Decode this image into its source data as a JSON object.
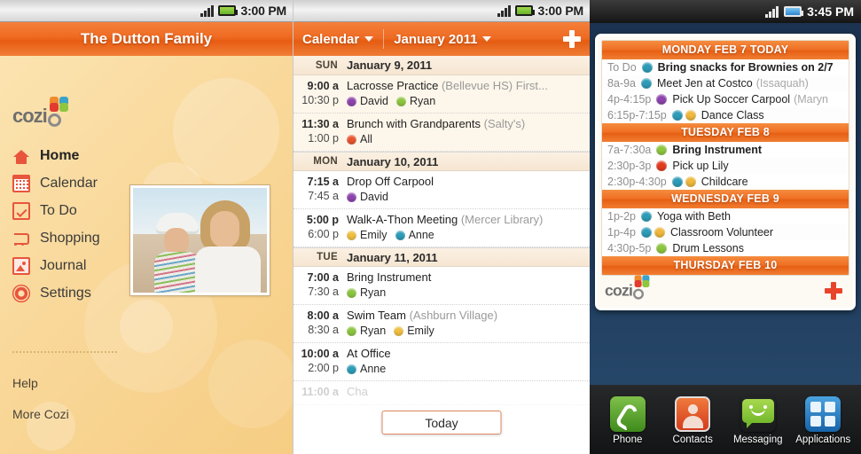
{
  "panel1": {
    "statusbar": {
      "time": "3:00 PM",
      "signal_icon": "signal-bars-icon",
      "battery_icon": "battery-icon"
    },
    "header_title": "The Dutton Family",
    "logo_text": "cozi",
    "nav": [
      {
        "label": "Home",
        "icon": "home-icon",
        "active": true
      },
      {
        "label": "Calendar",
        "icon": "calendar-icon",
        "active": false
      },
      {
        "label": "To Do",
        "icon": "checkbox-icon",
        "active": false
      },
      {
        "label": "Shopping",
        "icon": "cart-icon",
        "active": false
      },
      {
        "label": "Journal",
        "icon": "photo-icon",
        "active": false
      },
      {
        "label": "Settings",
        "icon": "gear-icon",
        "active": false
      }
    ],
    "links": [
      {
        "label": "Help"
      },
      {
        "label": "More Cozi"
      }
    ],
    "photo_alt": "family-photo"
  },
  "panel2": {
    "statusbar": {
      "time": "3:00 PM"
    },
    "header": {
      "menu_label": "Calendar",
      "month_label": "January 2011",
      "add_icon": "plus-icon"
    },
    "days": [
      {
        "dow": "SUN",
        "date": "January 9, 2011",
        "highlight": true,
        "events": [
          {
            "start": "9:00 a",
            "end": "10:30 p",
            "title": "Lacrosse Practice",
            "location": "(Bellevue HS) First...",
            "people": [
              {
                "name": "David",
                "color": "#8E44AD"
              },
              {
                "name": "Ryan",
                "color": "#8DC63F"
              }
            ]
          },
          {
            "start": "11:30 a",
            "end": "1:00 p",
            "title": "Brunch with Grandparents",
            "location": "(Salty's)",
            "people": [
              {
                "name": "All",
                "color": "#E8552E"
              }
            ]
          }
        ]
      },
      {
        "dow": "MON",
        "date": "January 10, 2011",
        "highlight": false,
        "events": [
          {
            "start": "7:15 a",
            "end": "7:45 a",
            "title": "Drop Off Carpool",
            "location": "",
            "people": [
              {
                "name": "David",
                "color": "#8E44AD"
              }
            ]
          },
          {
            "start": "5:00 p",
            "end": "6:00 p",
            "title": "Walk-A-Thon Meeting",
            "location": "(Mercer Library)",
            "people": [
              {
                "name": "Emily",
                "color": "#F0C040"
              },
              {
                "name": "Anne",
                "color": "#2D9CB8"
              }
            ]
          }
        ]
      },
      {
        "dow": "TUE",
        "date": "January 11, 2011",
        "highlight": false,
        "events": [
          {
            "start": "7:00 a",
            "end": "7:30 a",
            "title": "Bring Instrument",
            "location": "",
            "people": [
              {
                "name": "Ryan",
                "color": "#8DC63F"
              }
            ]
          },
          {
            "start": "8:00 a",
            "end": "8:30 a",
            "title": "Swim Team",
            "location": "(Ashburn Village)",
            "people": [
              {
                "name": "Ryan",
                "color": "#8DC63F"
              },
              {
                "name": "Emily",
                "color": "#F0C040"
              }
            ]
          },
          {
            "start": "10:00 a",
            "end": "2:00 p",
            "title": "At Office",
            "location": "",
            "people": [
              {
                "name": "Anne",
                "color": "#2D9CB8"
              }
            ]
          },
          {
            "start": "11:00 a",
            "end": "",
            "title": "Cha",
            "location": "",
            "faded": true,
            "people": []
          }
        ]
      }
    ],
    "today_button": "Today"
  },
  "panel3": {
    "statusbar": {
      "time": "3:45 PM"
    },
    "widget": {
      "logo_text": "cozi",
      "add_icon": "plus-icon",
      "days": [
        {
          "header": "MONDAY FEB 7 TODAY",
          "rows": [
            {
              "time": "To Do",
              "title": "Bring snacks for Brownies on 2/7",
              "location": "",
              "bold": true,
              "dots": [
                "#2D9CB8"
              ]
            },
            {
              "time": "8a-9a",
              "title": "Meet Jen at Costco",
              "location": "(Issaquah)",
              "bold": false,
              "dots": [
                "#2D9CB8"
              ]
            },
            {
              "time": "4p-4:15p",
              "title": "Pick Up Soccer Carpool",
              "location": "(Maryn",
              "bold": false,
              "dots": [
                "#8E44AD"
              ]
            },
            {
              "time": "6:15p-7:15p",
              "title": "Dance Class",
              "location": "",
              "bold": false,
              "dots": [
                "#2D9CB8",
                "#F0B83C"
              ]
            }
          ]
        },
        {
          "header": "TUESDAY FEB 8",
          "rows": [
            {
              "time": "7a-7:30a",
              "title": "Bring Instrument",
              "location": "",
              "bold": true,
              "dots": [
                "#8DC63F"
              ]
            },
            {
              "time": "2:30p-3p",
              "title": "Pick up Lily",
              "location": "",
              "bold": false,
              "dots": [
                "#E23B1E"
              ]
            },
            {
              "time": "2:30p-4:30p",
              "title": "Childcare",
              "location": "",
              "bold": false,
              "dots": [
                "#2D9CB8",
                "#F0B83C"
              ]
            }
          ]
        },
        {
          "header": "WEDNESDAY FEB 9",
          "rows": [
            {
              "time": "1p-2p",
              "title": "Yoga with Beth",
              "location": "",
              "bold": false,
              "dots": [
                "#2D9CB8"
              ]
            },
            {
              "time": "1p-4p",
              "title": "Classroom Volunteer",
              "location": "",
              "bold": false,
              "dots": [
                "#2D9CB8",
                "#F0B83C"
              ]
            },
            {
              "time": "4:30p-5p",
              "title": "Drum Lessons",
              "location": "",
              "bold": false,
              "dots": [
                "#8DC63F"
              ]
            }
          ]
        },
        {
          "header": "THURSDAY FEB 10",
          "rows": []
        }
      ]
    },
    "dock": [
      {
        "label": "Phone",
        "icon": "phone-icon"
      },
      {
        "label": "Contacts",
        "icon": "contacts-icon"
      },
      {
        "label": "Messaging",
        "icon": "message-icon"
      },
      {
        "label": "Applications",
        "icon": "apps-grid-icon"
      }
    ]
  }
}
